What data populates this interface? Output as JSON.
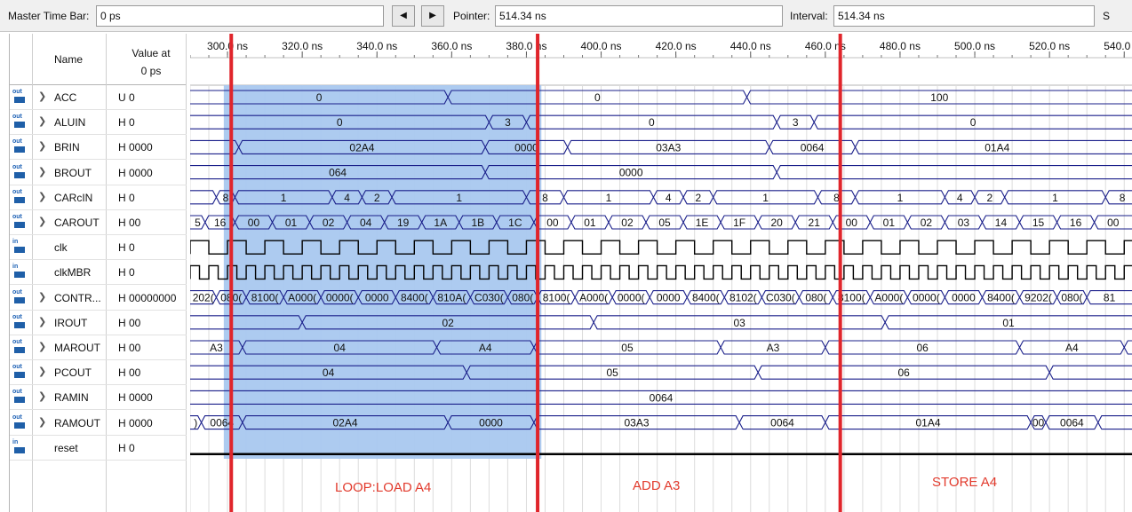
{
  "toolbar": {
    "master_label": "Master Time Bar:",
    "master_value": "0 ps",
    "prev_icon": "triangle-left-icon",
    "next_icon": "triangle-right-icon",
    "pointer_label": "Pointer:",
    "pointer_value": "514.34 ns",
    "interval_label": "Interval:",
    "interval_value": "514.34 ns",
    "trailing_label": "S"
  },
  "header": {
    "name": "Name",
    "value_line1": "Value at",
    "value_line2": "0 ps"
  },
  "time_axis": [
    "300.0 ns",
    "320.0 ns",
    "340.0 ns",
    "360.0 ns",
    "380.0 ns",
    "400.0 ns",
    "420.0 ns",
    "440.0 ns",
    "460.0 ns",
    "480.0 ns",
    "500.0 ns",
    "520.0 ns",
    "540.0 ns"
  ],
  "signals": [
    {
      "dir": "out",
      "name": "ACC",
      "value": "U 0",
      "bus": true
    },
    {
      "dir": "out",
      "name": "ALUIN",
      "value": "H 0",
      "bus": true
    },
    {
      "dir": "out",
      "name": "BRIN",
      "value": "H 0000",
      "bus": true
    },
    {
      "dir": "out",
      "name": "BROUT",
      "value": "H 0000",
      "bus": true
    },
    {
      "dir": "out",
      "name": "CARcIN",
      "value": "H 0",
      "bus": true
    },
    {
      "dir": "out",
      "name": "CAROUT",
      "value": "H 00",
      "bus": true
    },
    {
      "dir": "in",
      "name": "clk",
      "value": "H 0",
      "bus": false
    },
    {
      "dir": "in",
      "name": "clkMBR",
      "value": "H 0",
      "bus": false
    },
    {
      "dir": "out",
      "name": "CONTR...",
      "value": "H 00000000",
      "bus": true
    },
    {
      "dir": "out",
      "name": "IROUT",
      "value": "H 00",
      "bus": true
    },
    {
      "dir": "out",
      "name": "MAROUT",
      "value": "H 00",
      "bus": true
    },
    {
      "dir": "out",
      "name": "PCOUT",
      "value": "H 00",
      "bus": true
    },
    {
      "dir": "out",
      "name": "RAMIN",
      "value": "H 0000",
      "bus": true
    },
    {
      "dir": "out",
      "name": "RAMOUT",
      "value": "H 0000",
      "bus": true
    },
    {
      "dir": "in",
      "name": "reset",
      "value": "H 0",
      "bus": false
    }
  ],
  "waves": {
    "ACC": [
      {
        "t": 290,
        "v": "0"
      },
      {
        "t": 359,
        "v": "0"
      },
      {
        "t": 439,
        "v": "100"
      }
    ],
    "ALUIN": [
      {
        "t": 290,
        "v": "0"
      },
      {
        "t": 370,
        "v": "3"
      },
      {
        "t": 380,
        "v": "0"
      },
      {
        "t": 447,
        "v": "3"
      },
      {
        "t": 457,
        "v": "0"
      }
    ],
    "BRIN": [
      {
        "t": 290,
        "v": ""
      },
      {
        "t": 303,
        "v": "02A4"
      },
      {
        "t": 369,
        "v": "0000"
      },
      {
        "t": 391,
        "v": "03A3"
      },
      {
        "t": 445,
        "v": "0064"
      },
      {
        "t": 468,
        "v": "01A4"
      },
      {
        "t": 544,
        "v": ""
      }
    ],
    "BROUT": [
      {
        "t": 290,
        "v": "064"
      },
      {
        "t": 369,
        "v": "0000"
      },
      {
        "t": 447,
        "v": ""
      }
    ],
    "CARcIN": [
      {
        "t": 290,
        "v": ""
      },
      {
        "t": 297,
        "v": "8"
      },
      {
        "t": 302,
        "v": "1"
      },
      {
        "t": 328,
        "v": "4"
      },
      {
        "t": 336,
        "v": "2"
      },
      {
        "t": 344,
        "v": "1"
      },
      {
        "t": 380,
        "v": "8"
      },
      {
        "t": 390,
        "v": "1"
      },
      {
        "t": 414,
        "v": "4"
      },
      {
        "t": 422,
        "v": "2"
      },
      {
        "t": 430,
        "v": "1"
      },
      {
        "t": 458,
        "v": "8"
      },
      {
        "t": 468,
        "v": "1"
      },
      {
        "t": 492,
        "v": "4"
      },
      {
        "t": 500,
        "v": "2"
      },
      {
        "t": 508,
        "v": "1"
      },
      {
        "t": 535,
        "v": "8"
      },
      {
        "t": 544,
        "v": ""
      }
    ],
    "CAROUT": [
      {
        "t": 290,
        "v": "5"
      },
      {
        "t": 294,
        "v": "16"
      },
      {
        "t": 302,
        "v": "00"
      },
      {
        "t": 312,
        "v": "01"
      },
      {
        "t": 322,
        "v": "02"
      },
      {
        "t": 332,
        "v": "04"
      },
      {
        "t": 342,
        "v": "19"
      },
      {
        "t": 352,
        "v": "1A"
      },
      {
        "t": 362,
        "v": "1B"
      },
      {
        "t": 372,
        "v": "1C"
      },
      {
        "t": 382,
        "v": "00"
      },
      {
        "t": 392,
        "v": "01"
      },
      {
        "t": 402,
        "v": "02"
      },
      {
        "t": 412,
        "v": "05"
      },
      {
        "t": 422,
        "v": "1E"
      },
      {
        "t": 432,
        "v": "1F"
      },
      {
        "t": 442,
        "v": "20"
      },
      {
        "t": 452,
        "v": "21"
      },
      {
        "t": 462,
        "v": "00"
      },
      {
        "t": 472,
        "v": "01"
      },
      {
        "t": 482,
        "v": "02"
      },
      {
        "t": 492,
        "v": "03"
      },
      {
        "t": 502,
        "v": "14"
      },
      {
        "t": 512,
        "v": "15"
      },
      {
        "t": 522,
        "v": "16"
      },
      {
        "t": 532,
        "v": "00"
      }
    ],
    "CONTR...": [
      {
        "t": 290,
        "v": "202("
      },
      {
        "t": 297,
        "v": "080("
      },
      {
        "t": 305,
        "v": "8100("
      },
      {
        "t": 315,
        "v": "A000("
      },
      {
        "t": 325,
        "v": "0000("
      },
      {
        "t": 335,
        "v": "0000"
      },
      {
        "t": 345,
        "v": "8400("
      },
      {
        "t": 355,
        "v": "810A("
      },
      {
        "t": 365,
        "v": "C030("
      },
      {
        "t": 375,
        "v": "080("
      },
      {
        "t": 383,
        "v": "8100("
      },
      {
        "t": 393,
        "v": "A000("
      },
      {
        "t": 403,
        "v": "0000("
      },
      {
        "t": 413,
        "v": "0000"
      },
      {
        "t": 423,
        "v": "8400("
      },
      {
        "t": 433,
        "v": "8102("
      },
      {
        "t": 443,
        "v": "C030("
      },
      {
        "t": 453,
        "v": "080("
      },
      {
        "t": 462,
        "v": "8100("
      },
      {
        "t": 472,
        "v": "A000("
      },
      {
        "t": 482,
        "v": "0000("
      },
      {
        "t": 492,
        "v": "0000"
      },
      {
        "t": 502,
        "v": "8400("
      },
      {
        "t": 512,
        "v": "9202("
      },
      {
        "t": 522,
        "v": "080("
      },
      {
        "t": 530,
        "v": "81"
      }
    ],
    "IROUT": [
      {
        "t": 290,
        "v": ""
      },
      {
        "t": 320,
        "v": "02"
      },
      {
        "t": 398,
        "v": "03"
      },
      {
        "t": 476,
        "v": "01"
      }
    ],
    "MAROUT": [
      {
        "t": 290,
        "v": "A3"
      },
      {
        "t": 304,
        "v": "04"
      },
      {
        "t": 356,
        "v": "A4"
      },
      {
        "t": 382,
        "v": "05"
      },
      {
        "t": 432,
        "v": "A3"
      },
      {
        "t": 460,
        "v": "06"
      },
      {
        "t": 512,
        "v": "A4"
      },
      {
        "t": 540,
        "v": ""
      }
    ],
    "PCOUT": [
      {
        "t": 290,
        "v": "04"
      },
      {
        "t": 364,
        "v": "05"
      },
      {
        "t": 442,
        "v": "06"
      },
      {
        "t": 520,
        "v": ""
      }
    ],
    "RAMIN": [
      {
        "t": 290,
        "v": "0064"
      }
    ],
    "RAMOUT": [
      {
        "t": 290,
        "v": ")"
      },
      {
        "t": 293,
        "v": "0064"
      },
      {
        "t": 304,
        "v": "02A4"
      },
      {
        "t": 359,
        "v": "0000"
      },
      {
        "t": 382,
        "v": "03A3"
      },
      {
        "t": 437,
        "v": "0064"
      },
      {
        "t": 460,
        "v": "01A4"
      },
      {
        "t": 515,
        "v": "00"
      },
      {
        "t": 519,
        "v": "0064"
      },
      {
        "t": 533,
        "v": ""
      }
    ]
  },
  "highlight": {
    "t_start": 299,
    "t_end": 384
  },
  "markers": [
    301,
    383,
    464,
    543
  ],
  "annotations": [
    "LOOP:LOAD A4",
    "ADD A3",
    "STORE A4"
  ],
  "colors": {
    "wave": "#1a1f8a",
    "highlight": "#a9c8ef",
    "marker": "#e0252b",
    "annotation": "#e23a2c"
  }
}
